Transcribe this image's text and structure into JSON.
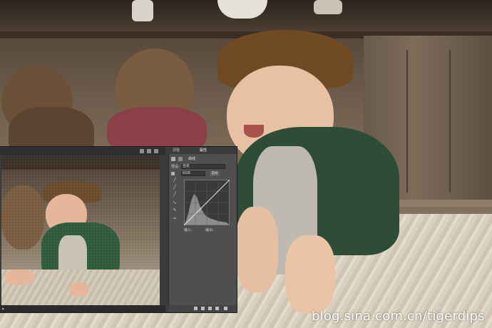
{
  "panel": {
    "tabs": [
      "调整",
      "属性"
    ],
    "title": "曲线",
    "preset_label": "预设:",
    "preset_value": "自定",
    "channel_value": "RGB",
    "auto_label": "自动",
    "input_label": "输入:",
    "output_label": "输出:"
  },
  "watermark": "blog.sina.com.cn/tigerdips",
  "colors": {
    "panel_bg": "#4f4f4f",
    "window_bg": "#3c3c3c",
    "histogram": "#8d8d8d",
    "curve_line": "#e8e8e8"
  }
}
